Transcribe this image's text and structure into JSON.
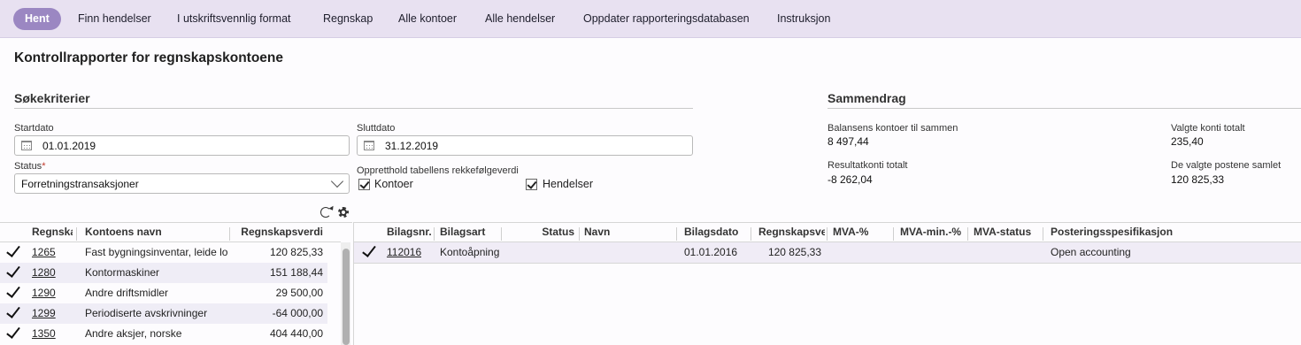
{
  "toolbar": {
    "buttons": [
      "Hent",
      "Finn hendelser",
      "I utskriftsvennlig format",
      "Regnskap",
      "Alle kontoer",
      "Alle hendelser",
      "Oppdater rapporteringsdatabasen",
      "Instruksjon"
    ]
  },
  "page_title": "Kontrollrapporter for regnskapskontoene",
  "search": {
    "title": "Søkekriterier",
    "start_label": "Startdato",
    "start_value": "01.01.2019",
    "end_label": "Sluttdato",
    "end_value": "31.12.2019",
    "status_label": "Status",
    "status_required_mark": "*",
    "status_value": "Forretningstransaksjoner",
    "keep_order_label": "Oppretthold tabellens rekkefølgeverdi",
    "check_accounts": "Kontoer",
    "check_events": "Hendelser"
  },
  "summary": {
    "title": "Sammendrag",
    "balance_label": "Balansens kontoer til sammen",
    "balance_value": "8 497,44",
    "result_label": "Resultatkonti totalt",
    "result_value": "-8 262,04",
    "selected_accounts_label": "Valgte konti totalt",
    "selected_accounts_value": "235,40",
    "selected_entries_label": "De valgte postene samlet",
    "selected_entries_value": "120 825,33"
  },
  "accounts_table": {
    "headers": [
      "Regnska",
      "Kontoens navn",
      "Regnskapsverdi"
    ],
    "rows": [
      {
        "account": "1265",
        "name": "Fast bygningsinventar, leide lo",
        "value": "120 825,33"
      },
      {
        "account": "1280",
        "name": "Kontormaskiner",
        "value": "151 188,44"
      },
      {
        "account": "1290",
        "name": "Andre driftsmidler",
        "value": "29 500,00"
      },
      {
        "account": "1299",
        "name": "Periodiserte avskrivninger",
        "value": "-64 000,00"
      },
      {
        "account": "1350",
        "name": "Andre aksjer, norske",
        "value": "404 440,00"
      }
    ]
  },
  "events_table": {
    "headers": [
      "Bilagsnr.",
      "Bilagsart",
      "Status",
      "Navn",
      "Bilagsdato",
      "Regnskapsve",
      "MVA-%",
      "MVA-min.-%",
      "MVA-status",
      "Posteringsspesifikasjon"
    ],
    "rows": [
      {
        "number": "112016",
        "type": "Kontoåpning",
        "status": "",
        "name": "",
        "date": "01.01.2016",
        "value": "120 825,33",
        "vat": "",
        "vat_min": "",
        "vat_status": "",
        "spec": "Open accounting"
      }
    ]
  }
}
